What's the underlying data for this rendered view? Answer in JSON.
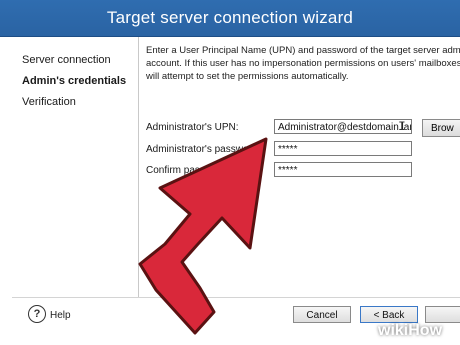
{
  "window": {
    "title": "Target server connection wizard"
  },
  "nav": {
    "items": [
      {
        "label": "Server connection",
        "active": false
      },
      {
        "label": "Admin's credentials",
        "active": true
      },
      {
        "label": "Verification",
        "active": false
      }
    ]
  },
  "intro": {
    "line1": "Enter a User Principal Name (UPN) and password of the target server administrat",
    "line2": "account. If this user has no impersonation permissions on users' mailboxes, the p",
    "line3": "will attempt to set the permissions automatically."
  },
  "form": {
    "upn_label": "Administrator's UPN:",
    "upn_value": "Administrator@destdomain.lan",
    "password_label": "Administrator's password:",
    "password_value": "*****",
    "confirm_label": "Confirm password:",
    "confirm_value": "*****",
    "browse_label": "Brow"
  },
  "footer": {
    "help_label": "Help",
    "help_icon_glyph": "?",
    "cancel_label": "Cancel",
    "back_label": "< Back"
  },
  "overlay": {
    "arrow_color": "#d9283a"
  },
  "watermark": {
    "brand_1": "wiki",
    "brand_2": "How"
  }
}
